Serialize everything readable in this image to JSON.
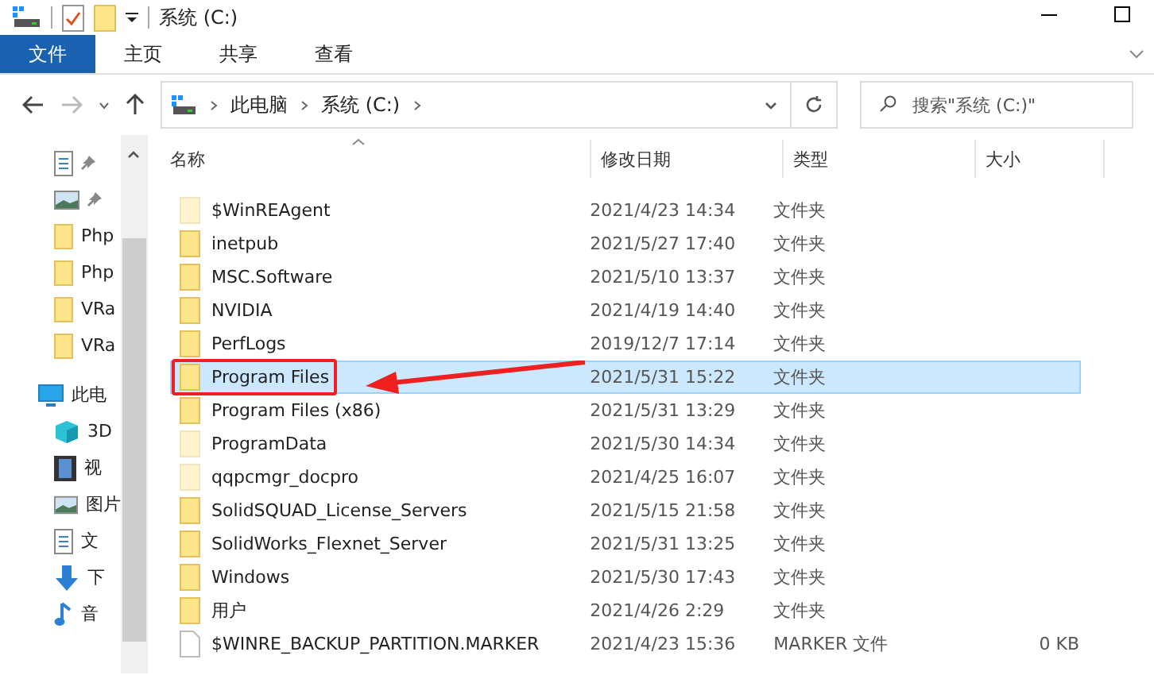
{
  "window": {
    "title": "系统 (C:)"
  },
  "ribbon_tabs": [
    {
      "label": "文件",
      "selected": true
    },
    {
      "label": "主页",
      "selected": false
    },
    {
      "label": "共享",
      "selected": false
    },
    {
      "label": "查看",
      "selected": false
    }
  ],
  "address": {
    "crumbs": [
      "此电脑",
      "系统 (C:)"
    ]
  },
  "search": {
    "placeholder": "搜索\"系统 (C:)\""
  },
  "sidebar": {
    "items": [
      {
        "kind": "doc",
        "pinned": true
      },
      {
        "kind": "image",
        "pinned": true
      },
      {
        "kind": "folder",
        "label": "Php",
        "pinned": false
      },
      {
        "kind": "folder",
        "label": "Php",
        "pinned": false
      },
      {
        "kind": "folder",
        "label": "VRa",
        "pinned": false
      },
      {
        "kind": "folder",
        "label": "VRa",
        "pinned": false
      },
      {
        "kind": "pc",
        "label": "此电",
        "pinned": false
      },
      {
        "kind": "cube",
        "label": "3D",
        "pinned": false
      },
      {
        "kind": "film",
        "label": "视",
        "pinned": false
      },
      {
        "kind": "image",
        "label": "图片",
        "pinned": false
      },
      {
        "kind": "doc",
        "label": "文",
        "pinned": false
      },
      {
        "kind": "download",
        "label": "下",
        "pinned": false
      },
      {
        "kind": "music",
        "label": "音",
        "pinned": false
      }
    ]
  },
  "table": {
    "columns": [
      "名称",
      "修改日期",
      "类型",
      "大小"
    ],
    "rows": [
      {
        "kind": "folder",
        "hidden": true,
        "name": "$WinREAgent",
        "date": "2021/4/23 14:34",
        "type": "文件夹",
        "selected": false,
        "callout": false
      },
      {
        "kind": "folder",
        "hidden": false,
        "name": "inetpub",
        "date": "2021/5/27 17:40",
        "type": "文件夹",
        "selected": false,
        "callout": false
      },
      {
        "kind": "folder",
        "hidden": false,
        "name": "MSC.Software",
        "date": "2021/5/10 13:37",
        "type": "文件夹",
        "selected": false,
        "callout": false
      },
      {
        "kind": "folder",
        "hidden": false,
        "name": "NVIDIA",
        "date": "2021/4/19 14:40",
        "type": "文件夹",
        "selected": false,
        "callout": false
      },
      {
        "kind": "folder",
        "hidden": false,
        "name": "PerfLogs",
        "date": "2019/12/7 17:14",
        "type": "文件夹",
        "selected": false,
        "callout": false
      },
      {
        "kind": "folder",
        "hidden": false,
        "name": "Program Files",
        "date": "2021/5/31 15:22",
        "type": "文件夹",
        "selected": true,
        "callout": true
      },
      {
        "kind": "folder",
        "hidden": false,
        "name": "Program Files (x86)",
        "date": "2021/5/31 13:29",
        "type": "文件夹",
        "selected": false,
        "callout": false
      },
      {
        "kind": "folder",
        "hidden": true,
        "name": "ProgramData",
        "date": "2021/5/30 14:34",
        "type": "文件夹",
        "selected": false,
        "callout": false
      },
      {
        "kind": "folder",
        "hidden": true,
        "name": "qqpcmgr_docpro",
        "date": "2021/4/25 16:07",
        "type": "文件夹",
        "selected": false,
        "callout": false
      },
      {
        "kind": "folder",
        "hidden": false,
        "name": "SolidSQUAD_License_Servers",
        "date": "2021/5/15 21:58",
        "type": "文件夹",
        "selected": false,
        "callout": false
      },
      {
        "kind": "folder",
        "hidden": false,
        "name": "SolidWorks_Flexnet_Server",
        "date": "2021/5/31 13:25",
        "type": "文件夹",
        "selected": false,
        "callout": false
      },
      {
        "kind": "folder",
        "hidden": false,
        "name": "Windows",
        "date": "2021/5/30 17:43",
        "type": "文件夹",
        "selected": false,
        "callout": false
      },
      {
        "kind": "folder",
        "hidden": false,
        "name": "用户",
        "date": "2021/4/26 2:29",
        "type": "文件夹",
        "selected": false,
        "callout": false
      },
      {
        "kind": "file",
        "hidden": false,
        "name": "$WINRE_BACKUP_PARTITION.MARKER",
        "date": "2021/4/23 15:36",
        "type": "MARKER 文件",
        "size": "0 KB",
        "selected": false,
        "callout": false
      }
    ]
  }
}
